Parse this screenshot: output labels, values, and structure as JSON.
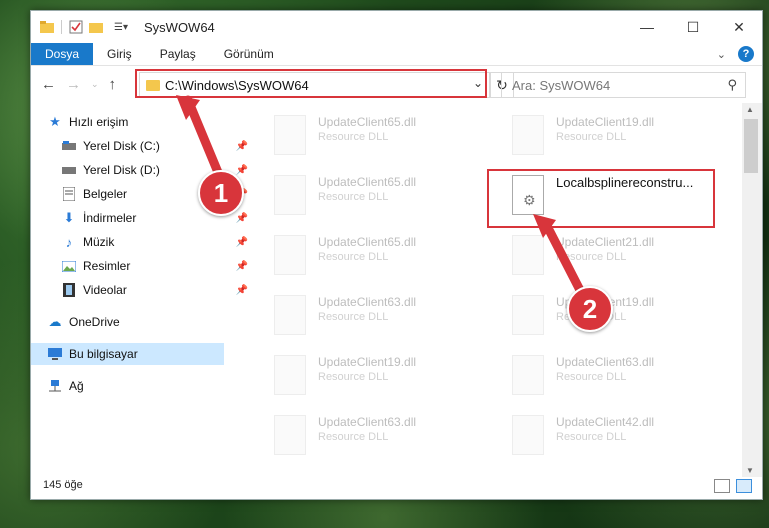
{
  "window": {
    "title": "SysWOW64"
  },
  "ribbon": {
    "tabs": [
      "Dosya",
      "Giriş",
      "Paylaş",
      "Görünüm"
    ],
    "help": "?"
  },
  "address": {
    "path": "C:\\Windows\\SysWOW64",
    "search_placeholder": "Ara: SysWOW64"
  },
  "sidebar": {
    "items": [
      {
        "label": "Hızlı erişim",
        "icon": "star-icon",
        "pinned": false
      },
      {
        "label": "Yerel Disk (C:)",
        "icon": "drive-icon",
        "pinned": true
      },
      {
        "label": "Yerel Disk (D:)",
        "icon": "drive-icon",
        "pinned": true
      },
      {
        "label": "Belgeler",
        "icon": "document-icon",
        "pinned": true
      },
      {
        "label": "İndirmeler",
        "icon": "download-icon",
        "pinned": true
      },
      {
        "label": "Müzik",
        "icon": "music-icon",
        "pinned": true
      },
      {
        "label": "Resimler",
        "icon": "pictures-icon",
        "pinned": true
      },
      {
        "label": "Videolar",
        "icon": "video-icon",
        "pinned": true
      },
      {
        "label": "OneDrive",
        "icon": "cloud-icon",
        "pinned": false
      },
      {
        "label": "Bu bilgisayar",
        "icon": "computer-icon",
        "pinned": false
      },
      {
        "label": "Ağ",
        "icon": "network-icon",
        "pinned": false
      }
    ]
  },
  "files": [
    {
      "name": "UpdateClient65.dll",
      "type": "Resource DLL"
    },
    {
      "name": "UpdateClient19.dll",
      "type": "Resource DLL"
    },
    {
      "name": "UpdateClient65.dll",
      "type": "Resource DLL"
    },
    {
      "name": "Localbsplinereconstru...",
      "type": ""
    },
    {
      "name": "UpdateClient65.dll",
      "type": "Resource DLL"
    },
    {
      "name": "UpdateClient21.dll",
      "type": "Resource DLL"
    },
    {
      "name": "UpdateClient63.dll",
      "type": "Resource DLL"
    },
    {
      "name": "UpdateClient19.dll",
      "type": "Resource DLL"
    },
    {
      "name": "UpdateClient19.dll",
      "type": "Resource DLL"
    },
    {
      "name": "UpdateClient63.dll",
      "type": "Resource DLL"
    },
    {
      "name": "UpdateClient63.dll",
      "type": "Resource DLL"
    },
    {
      "name": "UpdateClient42.dll",
      "type": "Resource DLL"
    }
  ],
  "status": {
    "count": "145 öğe"
  },
  "annotations": {
    "step1": "1",
    "step2": "2",
    "color": "#d8353b"
  }
}
